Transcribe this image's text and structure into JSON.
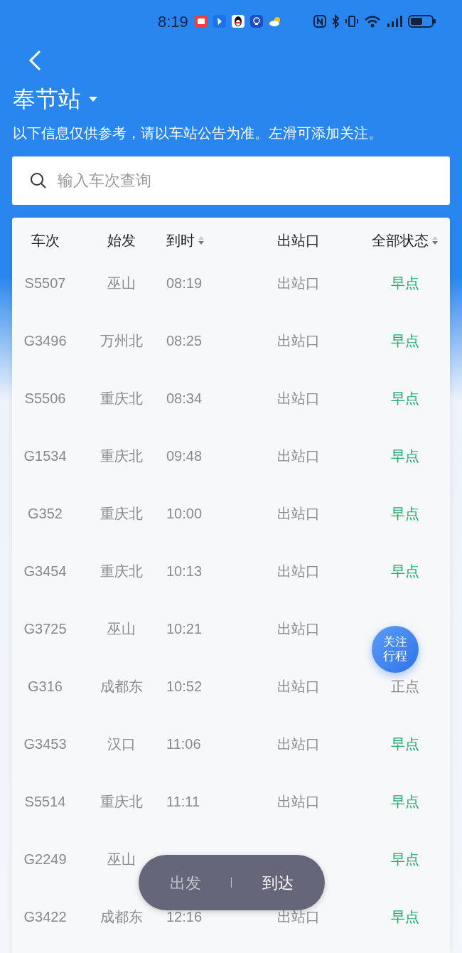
{
  "status_bar": {
    "time": "8:19"
  },
  "header": {
    "title": "奉节站",
    "subtitle": "以下信息仅供参考，请以车站公告为准。左滑可添加关注。"
  },
  "search": {
    "placeholder": "输入车次查询"
  },
  "table": {
    "columns": [
      {
        "label": "车次",
        "sortable": false
      },
      {
        "label": "始发",
        "sortable": false
      },
      {
        "label": "到时",
        "sortable": true
      },
      {
        "label": "出站口",
        "sortable": false
      },
      {
        "label": "全部状态",
        "sortable": true
      }
    ],
    "rows": [
      {
        "train": "S5507",
        "origin": "巫山",
        "arrival": "08:19",
        "exit": "出站口",
        "status": "早点",
        "kind": "early"
      },
      {
        "train": "G3496",
        "origin": "万州北",
        "arrival": "08:25",
        "exit": "出站口",
        "status": "早点",
        "kind": "early"
      },
      {
        "train": "S5506",
        "origin": "重庆北",
        "arrival": "08:34",
        "exit": "出站口",
        "status": "早点",
        "kind": "early"
      },
      {
        "train": "G1534",
        "origin": "重庆北",
        "arrival": "09:48",
        "exit": "出站口",
        "status": "早点",
        "kind": "early"
      },
      {
        "train": "G352",
        "origin": "重庆北",
        "arrival": "10:00",
        "exit": "出站口",
        "status": "早点",
        "kind": "early"
      },
      {
        "train": "G3454",
        "origin": "重庆北",
        "arrival": "10:13",
        "exit": "出站口",
        "status": "早点",
        "kind": "early"
      },
      {
        "train": "G3725",
        "origin": "巫山",
        "arrival": "10:21",
        "exit": "出站口"
      },
      {
        "train": "G316",
        "origin": "成都东",
        "arrival": "10:52",
        "exit": "出站口",
        "status": "正点",
        "kind": "ontime"
      },
      {
        "train": "G3453",
        "origin": "汉口",
        "arrival": "11:06",
        "exit": "出站口",
        "status": "早点",
        "kind": "early"
      },
      {
        "train": "S5514",
        "origin": "重庆北",
        "arrival": "11:11",
        "exit": "出站口",
        "status": "早点",
        "kind": "early"
      },
      {
        "train": "G2249",
        "origin": "巫山",
        "status": "早点",
        "kind": "early"
      },
      {
        "train": "G3422",
        "origin": "成都东",
        "arrival": "12:16",
        "exit": "出站口",
        "status": "早点",
        "kind": "early"
      }
    ]
  },
  "float_button": {
    "lines": [
      "关注",
      "行程"
    ]
  },
  "mode_toggle": [
    {
      "label": "出发",
      "selected": false
    },
    {
      "label": "到达",
      "selected": true
    }
  ]
}
